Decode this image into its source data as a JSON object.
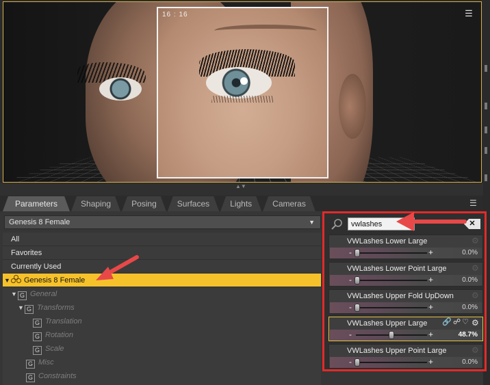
{
  "viewport": {
    "render_time": "16 : 16",
    "menu_icon": "viewport-menu-icon"
  },
  "tabs": [
    {
      "label": "Parameters",
      "active": true
    },
    {
      "label": "Shaping"
    },
    {
      "label": "Posing"
    },
    {
      "label": "Surfaces"
    },
    {
      "label": "Lights"
    },
    {
      "label": "Cameras"
    }
  ],
  "left_panel": {
    "node_select": "Genesis 8 Female",
    "tree": {
      "all": "All",
      "favorites": "Favorites",
      "currently_used": "Currently Used",
      "figure": "Genesis 8 Female",
      "general": "General",
      "transforms": "Transforms",
      "translation": "Translation",
      "rotation": "Rotation",
      "scale": "Scale",
      "misc": "Misc",
      "constraints": "Constraints"
    },
    "group_glyph": "G"
  },
  "right_panel": {
    "search_value": "vwlashes",
    "clear_label": "✕",
    "sliders": [
      {
        "label": "VWLashes Lower Large",
        "value_text": "0.0%",
        "value": 0.0
      },
      {
        "label": "VWLashes Lower Point Large",
        "value_text": "0.0%",
        "value": 0.0
      },
      {
        "label": "VWLashes Upper Fold UpDown",
        "value_text": "0.0%",
        "value": 0.0
      },
      {
        "label": "VWLashes Upper Large",
        "value_text": "48.7%",
        "value": 48.7,
        "active": true
      },
      {
        "label": "VWLashes Upper Point Large",
        "value_text": "0.0%",
        "value": 0.0
      }
    ]
  },
  "colors": {
    "accent": "#f6c22b",
    "highlight_frame": "#e32a2a",
    "viewport_border": "#d9b24a"
  }
}
